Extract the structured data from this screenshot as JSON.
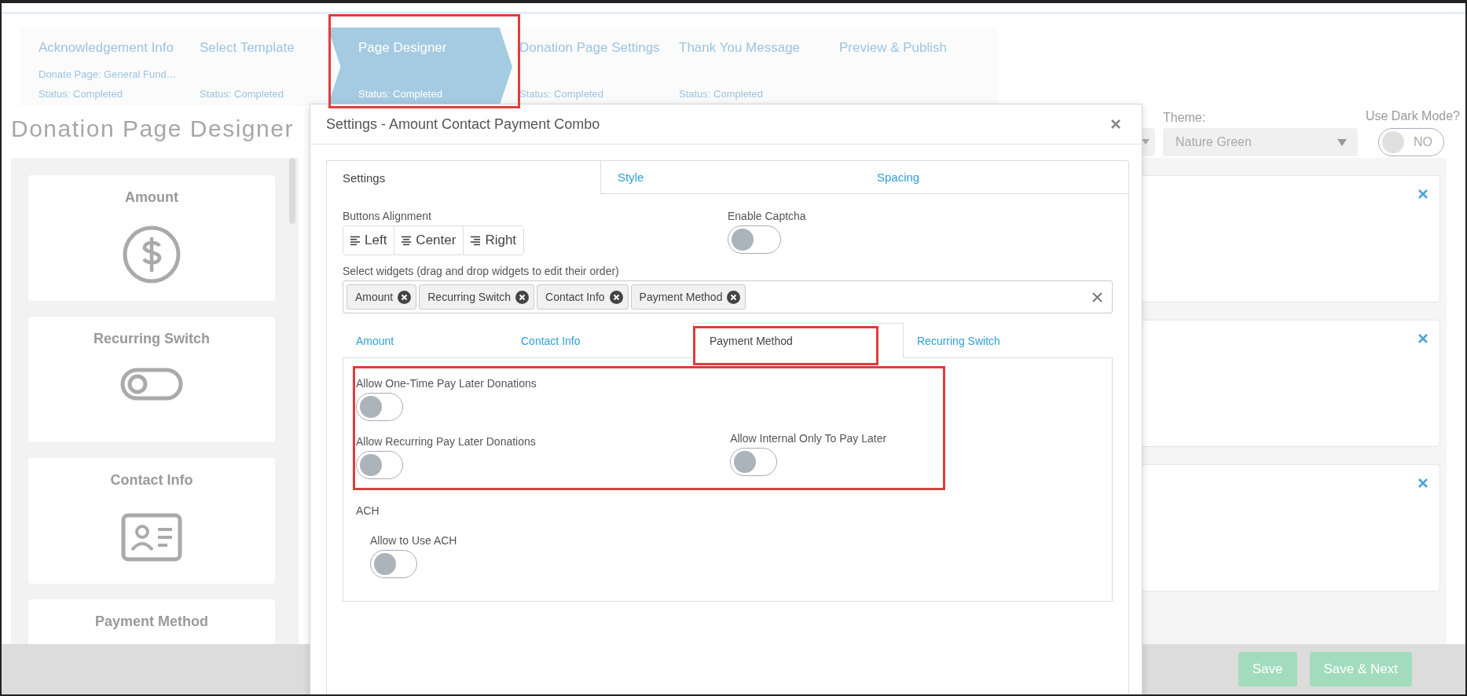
{
  "stepper": {
    "steps": [
      {
        "title": "Acknowledgement Info",
        "subtitle": "Donate Page: General Fund…",
        "status": "Status: Completed",
        "selected": false
      },
      {
        "title": "Select Template",
        "status": "Status: Completed",
        "selected": false
      },
      {
        "title": "Page Designer",
        "status": "Status: Completed",
        "selected": true
      },
      {
        "title": "Donation Page Settings",
        "status": "Status: Completed",
        "selected": false
      },
      {
        "title": "Thank You Message",
        "status": "Status: Completed",
        "selected": false
      },
      {
        "title": "Preview & Publish",
        "selected": false
      }
    ]
  },
  "page_title": "Donation Page Designer",
  "theme": {
    "label": "Theme:",
    "value": "Nature Green"
  },
  "dark_mode": {
    "label": "Use Dark Mode?",
    "on": false,
    "state_text": "NO"
  },
  "widget_palette": [
    {
      "label": "Amount",
      "kind": "amount"
    },
    {
      "label": "Recurring Switch",
      "kind": "switch"
    },
    {
      "label": "Contact Info",
      "kind": "contact"
    },
    {
      "label": "Payment Method",
      "kind": "payment"
    }
  ],
  "modal": {
    "title": "Settings - Amount Contact Payment Combo",
    "tabs": [
      {
        "label": "Settings",
        "selected": true
      },
      {
        "label": "Style",
        "selected": false
      },
      {
        "label": "Spacing",
        "selected": false
      }
    ],
    "buttons_alignment": {
      "label": "Buttons Alignment",
      "options": [
        {
          "label": "Left",
          "kind": "left"
        },
        {
          "label": "Center",
          "kind": "center"
        },
        {
          "label": "Right",
          "kind": "right"
        }
      ]
    },
    "captcha": {
      "label": "Enable Captcha",
      "on": false
    },
    "widgets_select": {
      "label": "Select widgets (drag and drop widgets to edit their order)",
      "chips": [
        "Amount",
        "Recurring Switch",
        "Contact Info",
        "Payment Method"
      ]
    },
    "widget_tabs": [
      {
        "label": "Amount",
        "selected": false
      },
      {
        "label": "Contact Info",
        "selected": false
      },
      {
        "label": "Payment Method",
        "selected": true
      },
      {
        "label": "Recurring Switch",
        "selected": false
      }
    ],
    "pay_later": [
      {
        "label": "Allow One-Time Pay Later Donations",
        "on": false
      },
      {
        "label": "Allow Recurring Pay Later Donations",
        "on": false
      },
      {
        "label": "Allow Internal Only To Pay Later",
        "on": false
      }
    ],
    "ach": {
      "heading": "ACH",
      "options": [
        {
          "label": "Allow to Use ACH",
          "on": false
        }
      ]
    }
  },
  "footer": {
    "buttons": [
      "Save",
      "Save & Next"
    ]
  }
}
